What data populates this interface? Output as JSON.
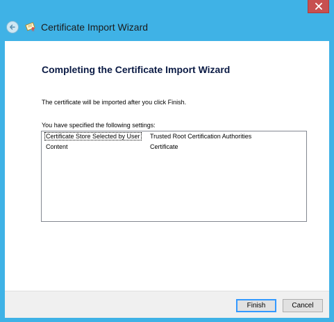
{
  "window": {
    "close_icon": "close-icon",
    "accent_color": "#3fb2e6"
  },
  "header": {
    "title": "Certificate Import Wizard",
    "back_icon": "back-arrow-icon",
    "wizard_icon": "certificate-icon"
  },
  "main": {
    "heading": "Completing the Certificate Import Wizard",
    "info_text": "The certificate will be imported after you click Finish.",
    "settings_label": "You have specified the following settings:",
    "settings": [
      {
        "key": "Certificate Store Selected by User",
        "value": "Trusted Root Certification Authorities"
      },
      {
        "key": "Content",
        "value": "Certificate"
      }
    ]
  },
  "footer": {
    "finish_label": "Finish",
    "cancel_label": "Cancel"
  }
}
